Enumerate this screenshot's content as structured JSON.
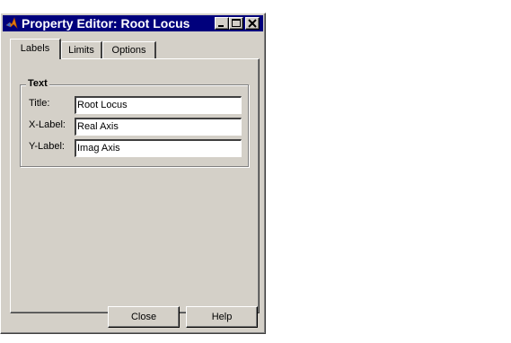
{
  "window": {
    "title": "Property Editor: Root Locus",
    "app_icon": "matlab-logo-icon",
    "controls": [
      "minimize-icon",
      "maximize-icon",
      "close-icon"
    ]
  },
  "tabs": [
    {
      "label": "Labels",
      "active": true
    },
    {
      "label": "Limits",
      "active": false
    },
    {
      "label": "Options",
      "active": false
    }
  ],
  "text_group": {
    "title": "Text",
    "fields": [
      {
        "label": "Title:",
        "value": "Root Locus"
      },
      {
        "label": "X-Label:",
        "value": "Real Axis"
      },
      {
        "label": "Y-Label:",
        "value": "Imag Axis"
      }
    ]
  },
  "buttons": {
    "close": "Close",
    "help": "Help"
  },
  "colors": {
    "titlebar": "#00007c",
    "face": "#d4d0c8"
  }
}
